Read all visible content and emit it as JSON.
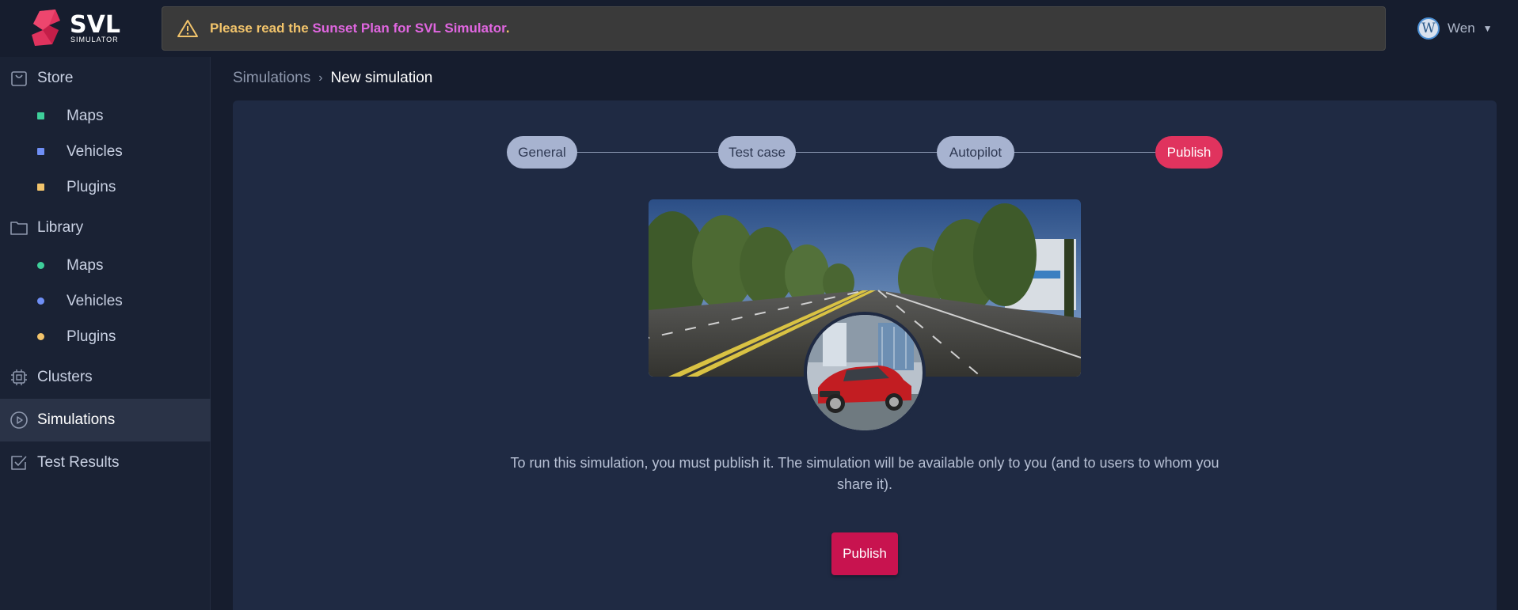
{
  "brand": {
    "name": "SVL",
    "subtitle": "SIMULATOR"
  },
  "banner": {
    "prefix": "Please read the ",
    "link": "Sunset Plan for SVL Simulator",
    "suffix": "."
  },
  "user": {
    "initial": "W",
    "name": "Wen"
  },
  "sidebar": {
    "store": {
      "label": "Store",
      "items": [
        {
          "label": "Maps",
          "color": "#3ecf9a"
        },
        {
          "label": "Vehicles",
          "color": "#6f8ff5"
        },
        {
          "label": "Plugins",
          "color": "#f2c46b"
        }
      ]
    },
    "library": {
      "label": "Library",
      "items": [
        {
          "label": "Maps",
          "color": "#3ecf9a"
        },
        {
          "label": "Vehicles",
          "color": "#6f8ff5"
        },
        {
          "label": "Plugins",
          "color": "#f2c46b"
        }
      ]
    },
    "clusters": "Clusters",
    "simulations": "Simulations",
    "test_results": "Test Results"
  },
  "breadcrumb": {
    "parent": "Simulations",
    "separator": "›",
    "current": "New simulation"
  },
  "steps": [
    "General",
    "Test case",
    "Autopilot",
    "Publish"
  ],
  "active_step": "Publish",
  "description": "To run this simulation, you must publish it. The simulation will be available only to you (and to users to whom you share it).",
  "publish_button": "Publish",
  "colors": {
    "accent": "#c8134f",
    "active_step": "#e0335e",
    "step": "#a7b3d0",
    "panel": "#1f2a43",
    "sidebar": "#1a2234"
  }
}
